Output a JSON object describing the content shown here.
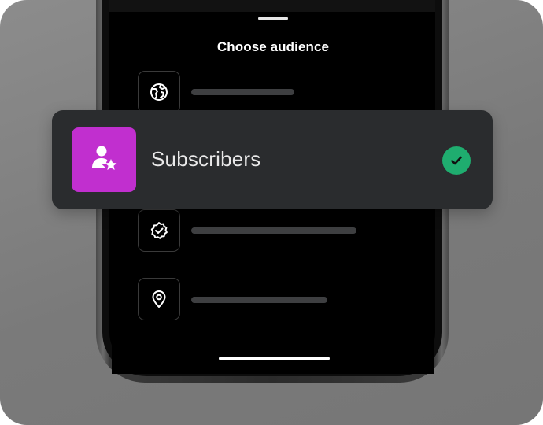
{
  "sheet": {
    "title": "Choose audience"
  },
  "options": [
    {
      "icon": "globe-icon"
    },
    {
      "icon": "verified-badge-icon"
    },
    {
      "icon": "location-pin-icon"
    }
  ],
  "selected_option": {
    "label": "Subscribers",
    "icon": "subscriber-star-icon",
    "selected": true
  },
  "colors": {
    "accent": "#c12fcf",
    "check": "#1fad6f",
    "card": "#2a2c2e",
    "background": "#808080"
  }
}
